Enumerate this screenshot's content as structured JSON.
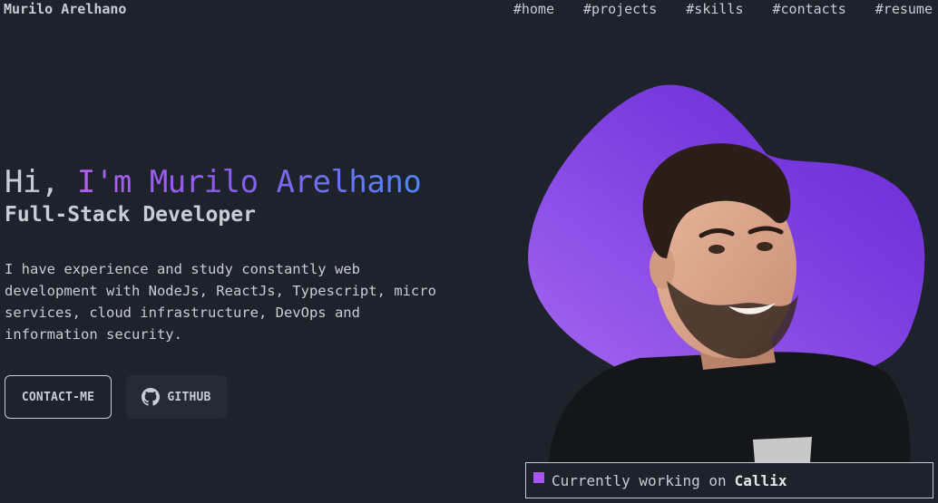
{
  "header": {
    "logo": "Murilo Arelhano",
    "nav": [
      "#home",
      "#projects",
      "#skills",
      "#contacts",
      "#resume"
    ]
  },
  "hero": {
    "greeting_prefix": "Hi, ",
    "greeting_name": "I'm Murilo Arelhano",
    "role": "Full-Stack Developer",
    "bio": "I have experience and study constantly web development with NodeJs, ReactJs, Typescript, micro services, cloud infrastructure, DevOps and information security.",
    "buttons": {
      "contact": "CONTACT-ME",
      "github": "GITHUB"
    }
  },
  "status": {
    "prefix": "Currently working on",
    "company": "Callix"
  },
  "colors": {
    "background": "#1e222b",
    "text": "#c8ccd4",
    "accent_purple": "#a855f7",
    "accent_blue": "#4f86f5"
  },
  "icons": {
    "github": "github-icon",
    "status": "square-icon"
  }
}
